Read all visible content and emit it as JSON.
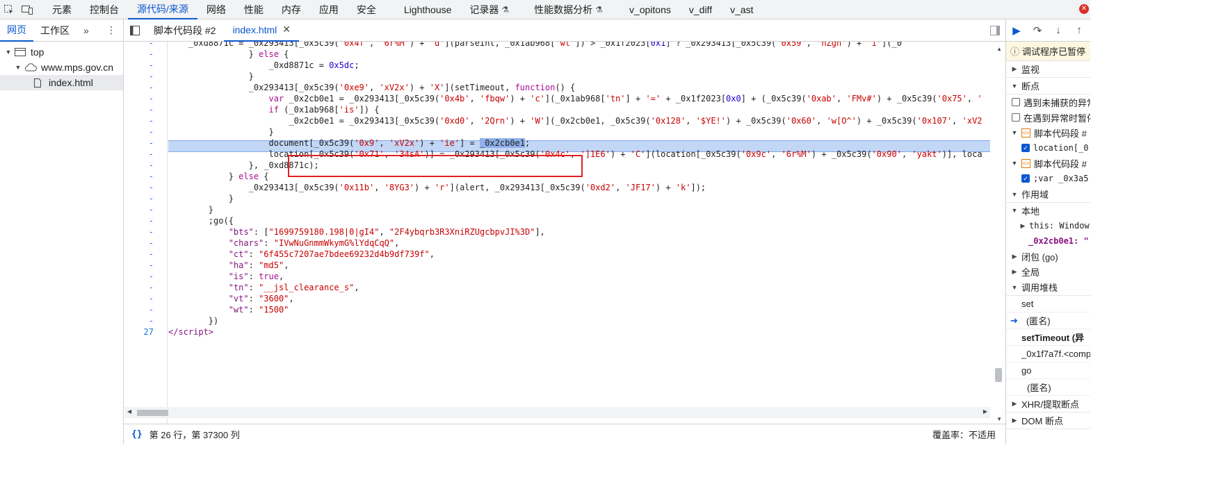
{
  "toolbar": {
    "tabs": [
      {
        "label": "元素"
      },
      {
        "label": "控制台"
      },
      {
        "label": "源代码/来源"
      },
      {
        "label": "网络"
      },
      {
        "label": "性能"
      },
      {
        "label": "内存"
      },
      {
        "label": "应用"
      },
      {
        "label": "安全"
      },
      {
        "label": "Lighthouse"
      },
      {
        "label": "记录器"
      },
      {
        "label": "性能数据分析"
      },
      {
        "label": "v_opitons"
      },
      {
        "label": "v_diff"
      },
      {
        "label": "v_ast"
      }
    ]
  },
  "navigator": {
    "tabs": [
      {
        "label": "网页"
      },
      {
        "label": "工作区"
      }
    ],
    "tree": [
      {
        "label": "top"
      },
      {
        "label": "www.mps.gov.cn"
      },
      {
        "label": "index.html"
      }
    ]
  },
  "editor": {
    "file_tabs": [
      {
        "label": "脚本代码段 #2"
      },
      {
        "label": "index.html"
      }
    ],
    "gutter": [
      "-",
      "-",
      "-",
      "-",
      "-",
      "-",
      "-",
      "-",
      "-",
      "-",
      "-",
      "-",
      "-",
      "-",
      "-",
      "-",
      "-",
      "-",
      "-",
      "-",
      "-",
      "-",
      "-",
      "-",
      "-",
      "-",
      "27"
    ],
    "status": {
      "position": "第 26 行，第 37300 列",
      "coverage": "覆盖率：不适用"
    }
  },
  "debugger": {
    "paused": "调试程序已暂停",
    "watch": "监视",
    "breakpoints": "断点",
    "pause_uncaught": "遇到未捕获的异常",
    "pause_caught": "在遇到异常时暂停",
    "snippet1": "脚本代码段 #",
    "bp1": "location[_0",
    "snippet2": "脚本代码段 #",
    "bp2": ";var _0x3a5",
    "scope": "作用域",
    "local": "本地",
    "this_label": "this: Window",
    "var_label": "_0x2cb0e1: \"",
    "closure": "闭包 (go)",
    "global": "全局",
    "callstack": "调用堆栈",
    "frames": [
      "set",
      "(匿名)",
      "setTimeout (异",
      "_0x1f7a7f.<comp",
      "go",
      "(匿名)"
    ],
    "xhr": "XHR/提取断点",
    "dom": "DOM 断点"
  }
}
